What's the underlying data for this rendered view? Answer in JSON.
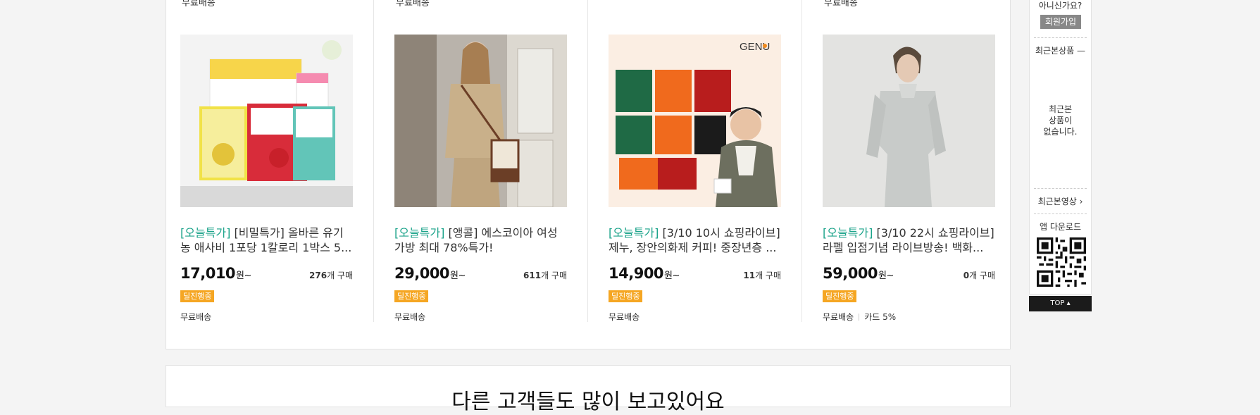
{
  "products": [
    {
      "promo": "[오늘특가]",
      "title_rest": " [비밀특가] 올바른 유기",
      "title_line2": "농 애사비 1포당 1칼로리 1박스 5...",
      "price": "17,010",
      "won": "원~",
      "sold_count": "276",
      "sold_suffix": "개 구매",
      "badge": "딜진행중",
      "shipping": "무료배송",
      "card_benefit": ""
    },
    {
      "promo": "[오늘특가]",
      "title_rest": " [앵콜] 에스코이아 여성",
      "title_line2": "가방 최대 78%특가!",
      "price": "29,000",
      "won": "원~",
      "sold_count": "611",
      "sold_suffix": "개 구매",
      "badge": "딜진행중",
      "shipping": "무료배송",
      "card_benefit": ""
    },
    {
      "promo": "[오늘특가]",
      "title_rest": " [3/10 10시 쇼핑라이브]",
      "title_line2": "제누, 장안의화제 커피! 중장년층 ...",
      "price": "14,900",
      "won": "원~",
      "sold_count": "11",
      "sold_suffix": "개 구매",
      "badge": "딜진행중",
      "shipping": "무료배송",
      "card_benefit": "",
      "brand_logo_text": "GENU"
    },
    {
      "promo": "[오늘특가]",
      "title_rest": " [3/10 22시 쇼핑라이브]",
      "title_line2": "라펠 입점기념 라이브방송! 백화...",
      "price": "59,000",
      "won": "원~",
      "sold_count": "0",
      "sold_suffix": "개 구매",
      "badge": "딜진행중",
      "shipping": "무료배송",
      "card_benefit": "카드 5%"
    }
  ],
  "previous_row": {
    "shipping_labels": [
      "무료배송",
      "무료배송",
      "무료배송"
    ]
  },
  "next_section": {
    "heading": "다른 고객들도 많이 보고있어요"
  },
  "sidebar": {
    "not_member_question": "아니신가요?",
    "join_label": "회원가입",
    "recent_products_label": "최근본상품 —",
    "recent_empty_text": "최근본\n상품이\n없습니다.",
    "recent_video_label": "최근본영상 ›",
    "app_download_label": "앱 다운로드",
    "top_label": "TOP ▴"
  },
  "colors": {
    "promo_green": "#1ba38a",
    "badge_orange": "#f5a623",
    "top_bar": "#1b1b1b"
  }
}
